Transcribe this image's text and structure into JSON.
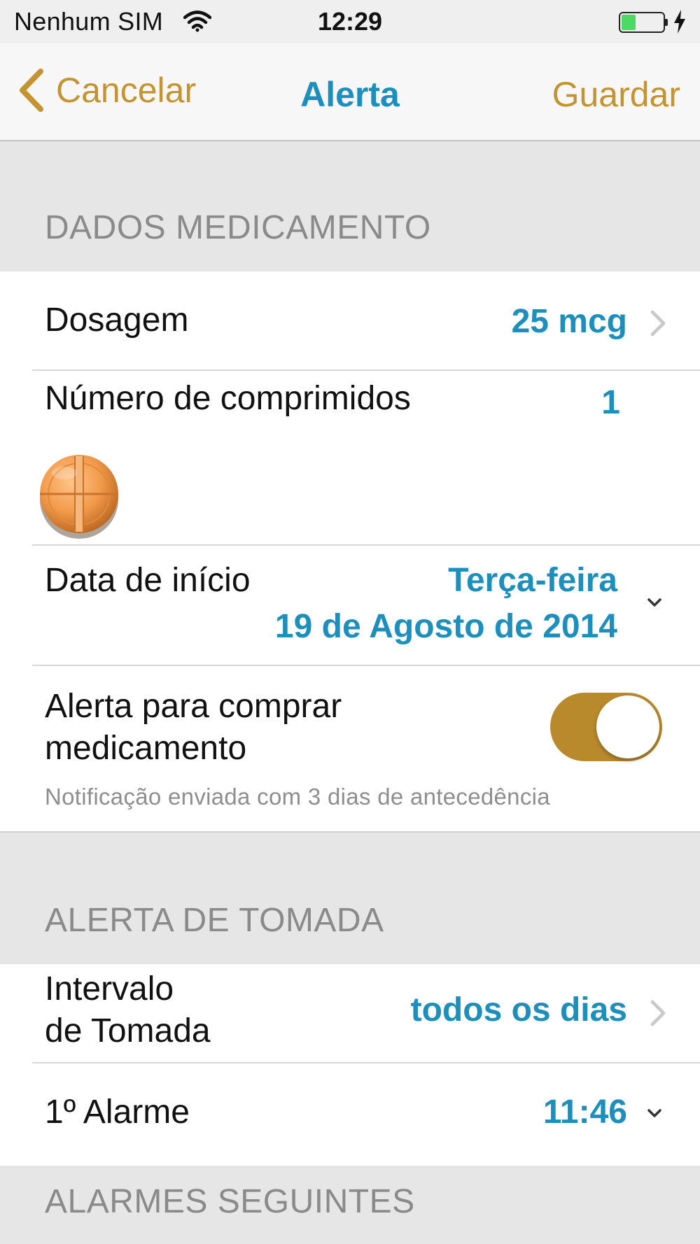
{
  "status_bar": {
    "carrier": "Nenhum SIM",
    "time": "12:29",
    "battery_level": 0.35,
    "charging": true
  },
  "nav": {
    "back_label": "Cancelar",
    "title": "Alerta",
    "save_label": "Guardar"
  },
  "colors": {
    "accent_gold": "#c49433",
    "value_blue": "#1c8fbd",
    "toggle_on": "#b98a2c",
    "battery_green": "#4cd964"
  },
  "sections": {
    "medication": {
      "header": "DADOS MEDICAMENTO",
      "dosage": {
        "label": "Dosagem",
        "value": "25 mcg"
      },
      "pills": {
        "label": "Número de comprimidos",
        "value": "1",
        "icon": "pill-icon"
      },
      "start_date": {
        "label": "Data de início",
        "weekday": "Terça-feira",
        "date": "19 de Agosto de 2014"
      },
      "buy_alert": {
        "label_line1": "Alerta para comprar",
        "label_line2": "medicamento",
        "enabled": true,
        "note": "Notificação enviada com 3 dias de antecedência"
      }
    },
    "intake": {
      "header": "ALERTA DE TOMADA",
      "interval": {
        "label_line1": "Intervalo",
        "label_line2": "de Tomada",
        "value": "todos os dias"
      },
      "first_alarm": {
        "label": "1º Alarme",
        "value": "11:46"
      }
    },
    "following": {
      "header": "ALARMES SEGUINTES"
    }
  }
}
